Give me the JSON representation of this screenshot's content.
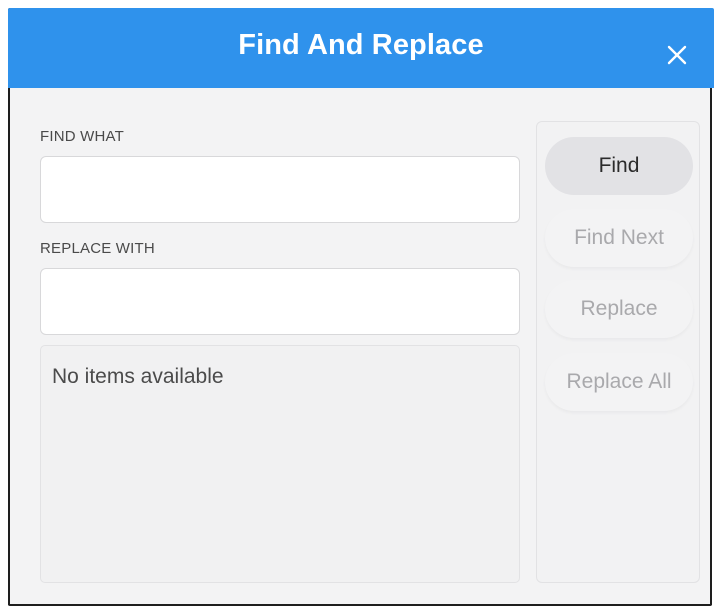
{
  "dialog": {
    "title": "Find And Replace",
    "close_icon": "close-icon",
    "find_label": "FIND WHAT",
    "find_value": "",
    "replace_label": "REPLACE WITH",
    "replace_value": "",
    "results_empty_text": "No items available",
    "buttons": {
      "find": "Find",
      "find_next": "Find Next",
      "replace": "Replace",
      "replace_all": "Replace All"
    },
    "colors": {
      "titlebar": "#2f92ec",
      "background": "#f3f3f4",
      "disabled_text": "#a9a9ac"
    }
  }
}
